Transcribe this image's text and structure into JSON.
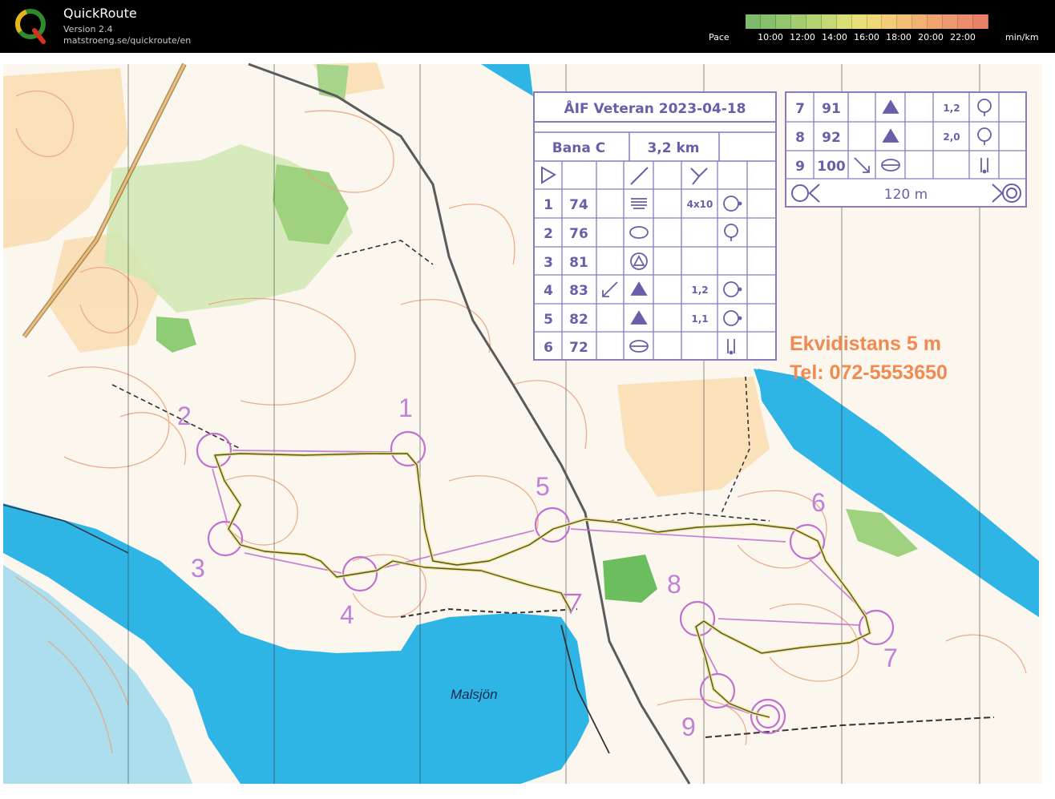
{
  "app": {
    "title": "QuickRoute",
    "version": "Version 2.4",
    "url": "matstroeng.se/quickroute/en"
  },
  "pace": {
    "label": "Pace",
    "ticks": [
      "10:00",
      "12:00",
      "14:00",
      "16:00",
      "18:00",
      "20:00",
      "22:00"
    ],
    "unit": "min/km",
    "colors": [
      "#7dbb6a",
      "#86c06c",
      "#93c76e",
      "#a3cd70",
      "#b4d372",
      "#c6d874",
      "#d9de76",
      "#e9df78",
      "#f0d878",
      "#f2cc76",
      "#f2bf74",
      "#f1b172",
      "#efa470",
      "#ed986e",
      "#eb8c6c",
      "#e9806a"
    ]
  },
  "course": {
    "title": "ÅIF Veteran 2023-04-18",
    "class": "Bana C",
    "length": "3,2 km",
    "controls": [
      {
        "n": "1",
        "code": "74",
        "dim": "4x10"
      },
      {
        "n": "2",
        "code": "76",
        "dim": ""
      },
      {
        "n": "3",
        "code": "81",
        "dim": ""
      },
      {
        "n": "4",
        "code": "83",
        "dim": "1,2"
      },
      {
        "n": "5",
        "code": "82",
        "dim": "1,1"
      },
      {
        "n": "6",
        "code": "72",
        "dim": ""
      },
      {
        "n": "7",
        "code": "91",
        "dim": "1,2"
      },
      {
        "n": "8",
        "code": "92",
        "dim": "2,0"
      },
      {
        "n": "9",
        "code": "100",
        "dim": ""
      }
    ],
    "finish_distance": "120 m"
  },
  "map": {
    "contour_note": "Ekvidistans 5 m",
    "phone": "Tel: 072-5553650",
    "lake_name": "Malsjön",
    "water_color": "#2fb4e6",
    "course_color": "#c070d0",
    "route_color": "#4a5a30"
  }
}
